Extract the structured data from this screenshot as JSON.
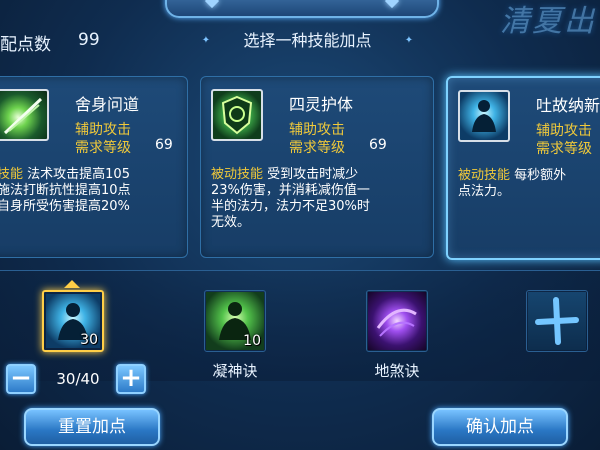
{
  "header": {
    "brand_deco": "清夏出",
    "points_label": "配点数",
    "points_value": "99",
    "prompt": "选择一种技能加点"
  },
  "cards": [
    {
      "name": "舍身问道",
      "type_label": "辅助攻击",
      "req_label": "需求等级",
      "req_value": "69",
      "desc_kw": "技能",
      "desc_text": "  法术攻击提高105\n施法打断抗性提高10点\n自身所受伤害提高20%",
      "icon": "sword-strike-icon",
      "selected": false
    },
    {
      "name": "四灵护体",
      "type_label": "辅助攻击",
      "req_label": "需求等级",
      "req_value": "69",
      "desc_kw": "被动技能",
      "desc_text": "  受到攻击时减少\n23%伤害，并消耗减伤值一\n半的法力，法力不足30%时\n无效。",
      "icon": "shield-rune-icon",
      "selected": false
    },
    {
      "name": "吐故纳新",
      "type_label": "辅助攻击",
      "req_label": "需求等级",
      "req_value": "",
      "desc_kw": "被动技能",
      "desc_text": "  每秒额外\n点法力。",
      "icon": "meditation-icon",
      "selected": true
    }
  ],
  "skills": [
    {
      "label": "",
      "count": "30",
      "icon": "meditation-icon",
      "selected": true
    },
    {
      "label": "凝神诀",
      "count": "10",
      "icon": "meditation-green-icon",
      "selected": false
    },
    {
      "label": "地煞诀",
      "count": "",
      "icon": "purple-vortex-icon",
      "selected": false
    },
    {
      "label": "",
      "count": "",
      "icon": "cross-blade-icon",
      "selected": false
    }
  ],
  "allocation": {
    "minus": "−",
    "plus": "+",
    "ratio": "30/40"
  },
  "buttons": {
    "reset": "重置加点",
    "confirm": "确认加点"
  },
  "colors": {
    "accent_gold": "#f0c93a",
    "selection_blue": "#7fd2ff",
    "slot_gold": "#ffce47"
  }
}
